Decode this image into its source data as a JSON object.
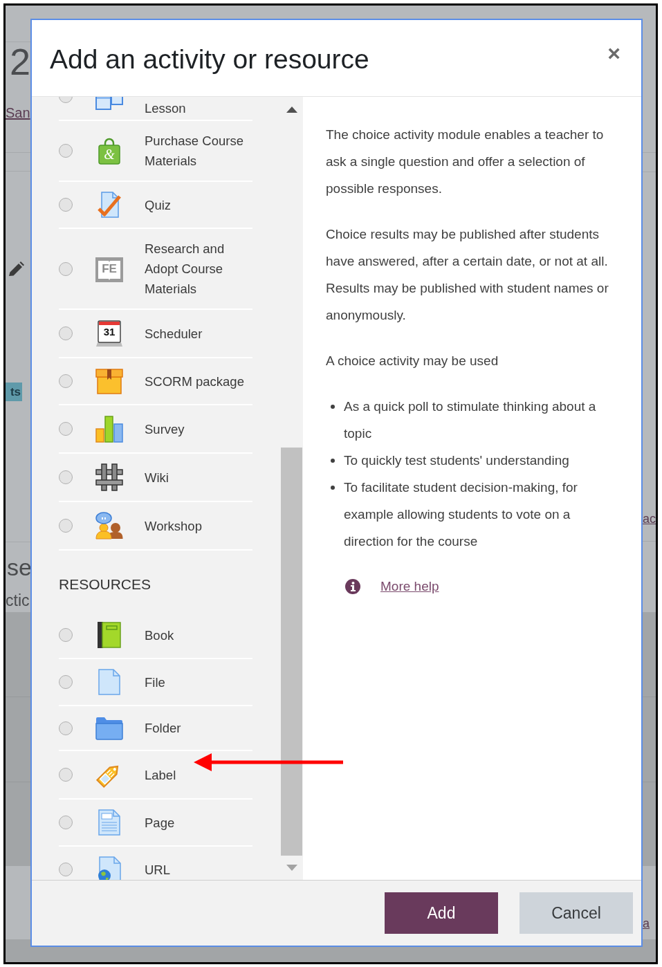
{
  "background_page": {
    "heading": "2",
    "link": "San",
    "badge": "ts",
    "section_title": "se",
    "section_subtitle": "ctic",
    "right_links": [
      "ac",
      "a"
    ]
  },
  "dialog": {
    "title": "Add an activity or resource",
    "close": "×"
  },
  "chooser": {
    "activities": [
      {
        "kind": "lesson",
        "label": "Lesson",
        "selected": false
      },
      {
        "kind": "purchase",
        "label": "Purchase Course Materials",
        "icon_text": "&",
        "selected": false
      },
      {
        "kind": "quiz",
        "label": "Quiz",
        "selected": false
      },
      {
        "kind": "research",
        "label": "Research and Adopt Course Materials",
        "icon_text": "FE",
        "selected": false
      },
      {
        "kind": "scheduler",
        "label": "Scheduler",
        "icon_text": "31",
        "selected": false
      },
      {
        "kind": "scorm",
        "label": "SCORM package",
        "selected": false
      },
      {
        "kind": "survey",
        "label": "Survey",
        "selected": false
      },
      {
        "kind": "wiki",
        "label": "Wiki",
        "selected": false
      },
      {
        "kind": "workshop",
        "label": "Workshop",
        "selected": false
      }
    ],
    "resources_heading": "RESOURCES",
    "resources": [
      {
        "kind": "book",
        "label": "Book",
        "selected": false
      },
      {
        "kind": "file",
        "label": "File",
        "selected": false
      },
      {
        "kind": "folder",
        "label": "Folder",
        "selected": false
      },
      {
        "kind": "label",
        "label": "Label",
        "selected": false
      },
      {
        "kind": "page",
        "label": "Page",
        "selected": false
      },
      {
        "kind": "url",
        "label": "URL",
        "selected": false
      }
    ]
  },
  "description": {
    "paragraphs": [
      "The choice activity module enables a teacher to ask a single question and offer a selection of possible responses.",
      "Choice results may be published after students have answered, after a certain date, or not at all. Results may be published with student names or anonymously.",
      "A choice activity may be used"
    ],
    "uses": [
      "As a quick poll to stimulate thinking about a topic",
      "To quickly test students' understanding",
      "To facilitate student decision-making, for example allowing students to vote on a direction for the course"
    ],
    "help_link": "More help"
  },
  "buttons": [
    {
      "kind": "primary",
      "label": "Add"
    },
    {
      "kind": "secondary",
      "label": "Cancel"
    }
  ]
}
